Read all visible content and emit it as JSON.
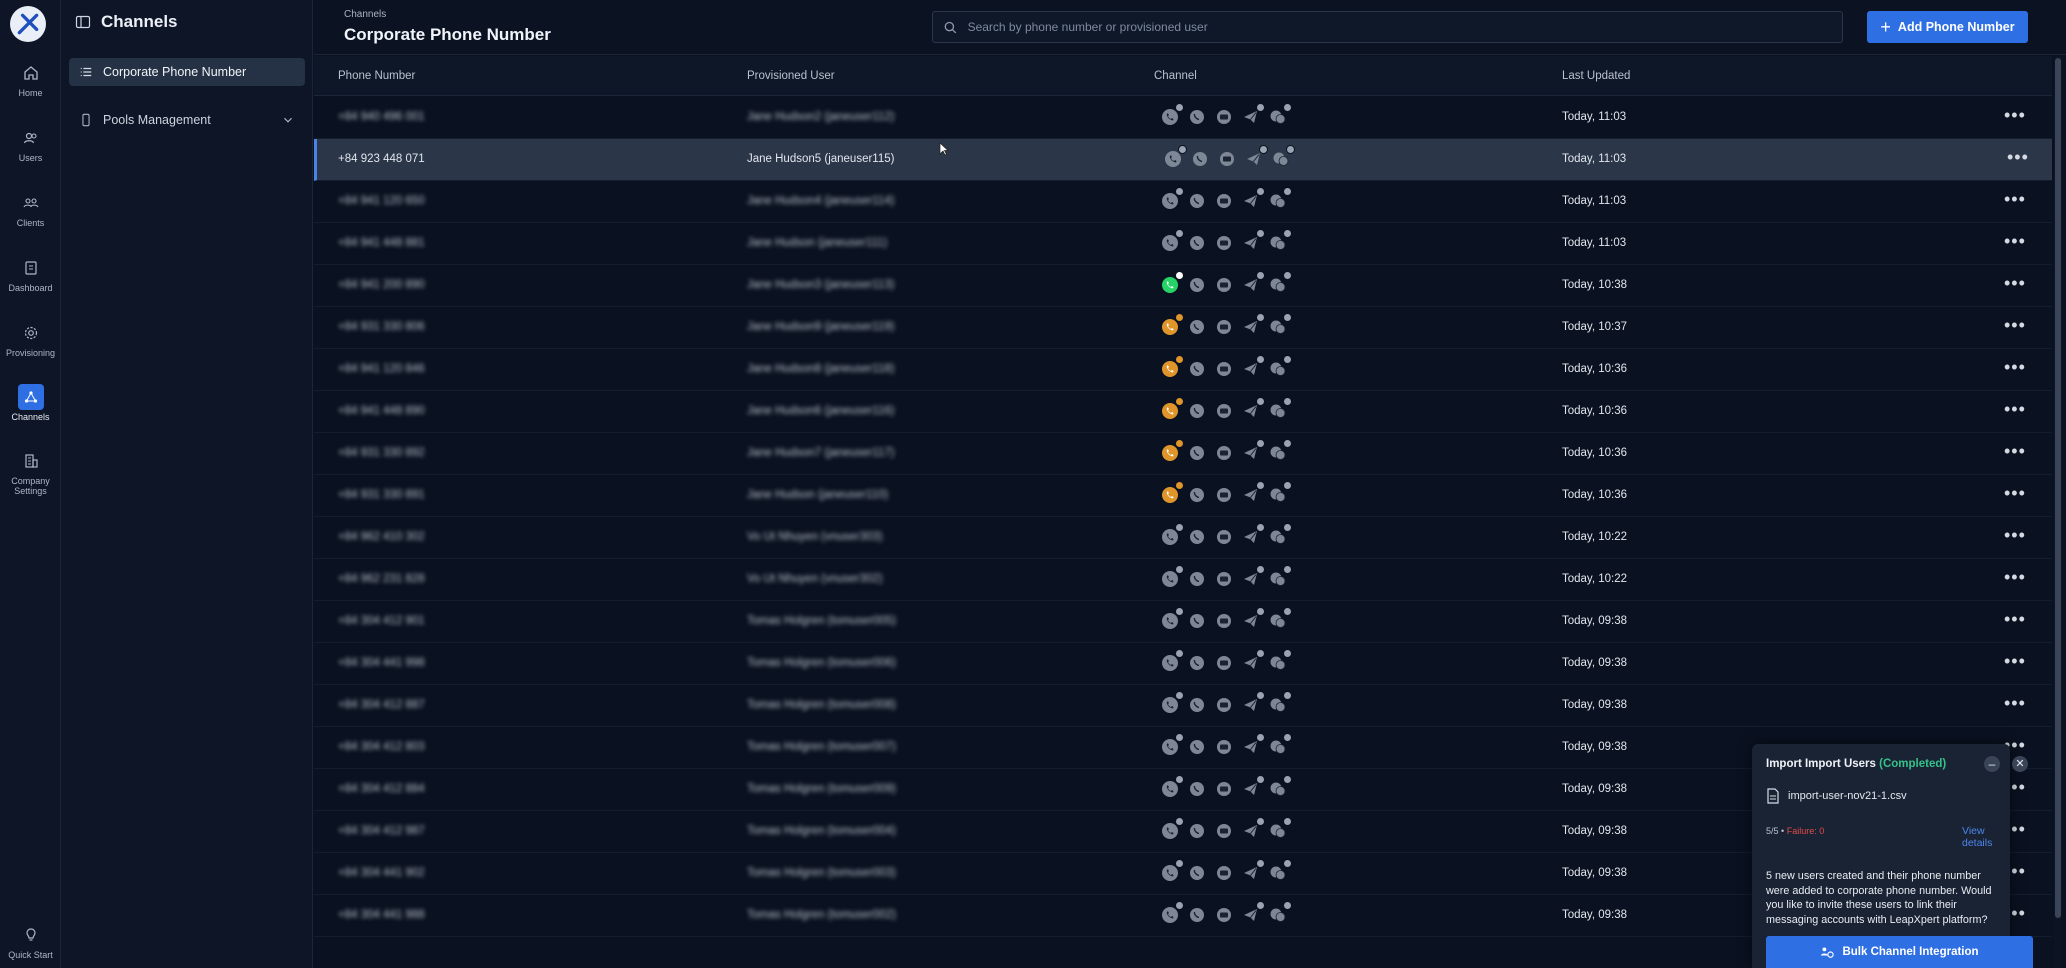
{
  "rail": {
    "items": [
      {
        "label": "Home",
        "icon": "home-icon"
      },
      {
        "label": "Users",
        "icon": "users-icon"
      },
      {
        "label": "Clients",
        "icon": "clients-icon"
      },
      {
        "label": "Dashboard",
        "icon": "dashboard-icon"
      },
      {
        "label": "Provisioning",
        "icon": "gear-icon"
      },
      {
        "label": "Channels",
        "icon": "channels-icon"
      },
      {
        "label": "Company Settings",
        "icon": "company-settings-icon"
      }
    ],
    "quick_start": "Quick Start"
  },
  "sidebar": {
    "title": "Channels",
    "items": [
      {
        "label": "Corporate Phone Number"
      },
      {
        "label": "Pools Management"
      }
    ]
  },
  "header": {
    "breadcrumb": "Channels",
    "title": "Corporate Phone Number",
    "search_placeholder": "Search by phone number or provisioned user",
    "add_button": "Add Phone Number"
  },
  "table": {
    "columns": [
      "Phone Number",
      "Provisioned User",
      "Channel",
      "Last Updated"
    ],
    "rows": [
      {
        "phone": "+84 940 496 001",
        "user": "Jane Hudson2 (janeuser112)",
        "updated": "Today, 11:03",
        "status": "none"
      },
      {
        "phone": "+84 923 448 071",
        "user": "Jane Hudson5 (janeuser115)",
        "updated": "Today, 11:03",
        "status": "none"
      },
      {
        "phone": "+84 941 120 650",
        "user": "Jane Hudson4 (janeuser114)",
        "updated": "Today, 11:03",
        "status": "none"
      },
      {
        "phone": "+84 941 448 881",
        "user": "Jane Hudson (janeuser111)",
        "updated": "Today, 11:03",
        "status": "none"
      },
      {
        "phone": "+84 941 200 890",
        "user": "Jane Hudson3 (janeuser113)",
        "updated": "Today, 10:38",
        "status": "whatsapp"
      },
      {
        "phone": "+84 931 330 806",
        "user": "Jane Hudson9 (janeuser119)",
        "updated": "Today, 10:37",
        "status": "pending"
      },
      {
        "phone": "+84 941 120 846",
        "user": "Jane Hudson8 (janeuser118)",
        "updated": "Today, 10:36",
        "status": "pending"
      },
      {
        "phone": "+84 941 448 890",
        "user": "Jane Hudson6 (janeuser116)",
        "updated": "Today, 10:36",
        "status": "pending"
      },
      {
        "phone": "+84 931 330 892",
        "user": "Jane Hudson7 (janeuser117)",
        "updated": "Today, 10:36",
        "status": "pending"
      },
      {
        "phone": "+84 931 330 891",
        "user": "Jane Hudson (janeuser110)",
        "updated": "Today, 10:36",
        "status": "pending"
      },
      {
        "phone": "+84 962 410 302",
        "user": "Vo Ut Nhuyen (vnuser303)",
        "updated": "Today, 10:22",
        "status": "none"
      },
      {
        "phone": "+84 962 231 828",
        "user": "Vo Ut Nhuyen (vnuser302)",
        "updated": "Today, 10:22",
        "status": "none"
      },
      {
        "phone": "+84 304 412 901",
        "user": "Tomas Holgren (tomuser005)",
        "updated": "Today, 09:38",
        "status": "none"
      },
      {
        "phone": "+84 304 441 998",
        "user": "Tomas Holgren (tomuser006)",
        "updated": "Today, 09:38",
        "status": "none"
      },
      {
        "phone": "+84 304 412 887",
        "user": "Tomas Holgren (tomuser008)",
        "updated": "Today, 09:38",
        "status": "none"
      },
      {
        "phone": "+84 304 412 803",
        "user": "Tomas Holgren (tomuser007)",
        "updated": "Today, 09:38",
        "status": "none"
      },
      {
        "phone": "+84 304 412 884",
        "user": "Tomas Holgren (tomuser009)",
        "updated": "Today, 09:38",
        "status": "none"
      },
      {
        "phone": "+84 304 412 987",
        "user": "Tomas Holgren (tomuser004)",
        "updated": "Today, 09:38",
        "status": "none"
      },
      {
        "phone": "+84 304 441 902",
        "user": "Tomas Holgren (tomuser003)",
        "updated": "Today, 09:38",
        "status": "none"
      },
      {
        "phone": "+84 304 441 988",
        "user": "Tomas Holgren (tomuser002)",
        "updated": "Today, 09:38",
        "status": "none"
      }
    ],
    "selected_row": 1
  },
  "import_popup": {
    "title_prefix": "Import Import Users",
    "title_status": "(Completed)",
    "file_name": "import-user-nov21-1.csv",
    "count": "5/5",
    "separator": "•",
    "failure": "Failure: 0",
    "view_details": "View details",
    "message": "5 new users created and their phone number were added to corporate phone number. Would you like to invite these users to link their messaging accounts with LeapXpert platform?",
    "bulk_button": "Bulk Channel Integration"
  },
  "colors": {
    "accent": "#2f6fe4",
    "success": "#35c28a",
    "failure": "#e14b4b",
    "pending": "#e0952a",
    "whatsapp": "#25d366"
  }
}
